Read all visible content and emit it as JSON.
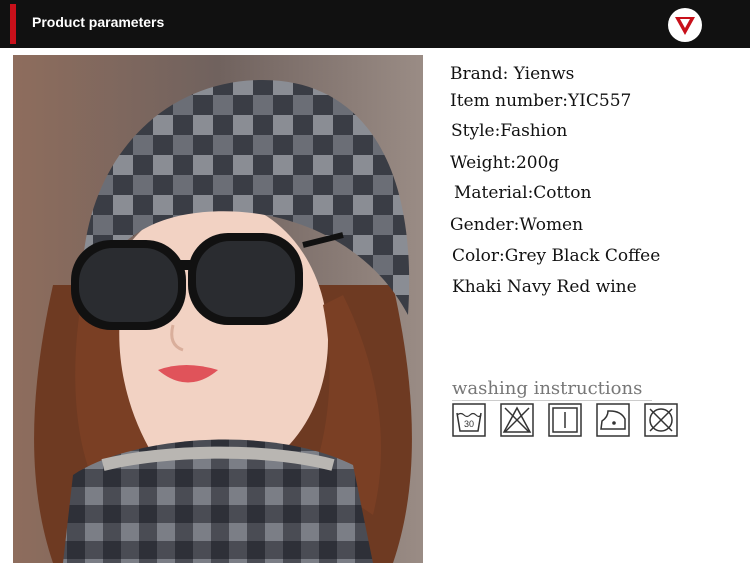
{
  "header": {
    "title": "Product parameters",
    "accent_color": "#c8101a",
    "logo_icon": "red-v-logo-icon"
  },
  "photo": {
    "subject": "woman-wearing-plaid-knit-beanie-scarf-and-sunglasses"
  },
  "params": [
    "Brand: Yienws",
    "Item number:YIC557",
    "Style:Fashion",
    "Weight:200g",
    "Material:Cotton",
    "Gender:Women",
    "Color:Grey Black Coffee",
    "Khaki Navy Red wine"
  ],
  "washing": {
    "title": "washing instructions",
    "wash_temp": "30",
    "icons": [
      "wash-30-icon",
      "do-not-bleach-icon",
      "line-dry-icon",
      "low-iron-icon",
      "do-not-dry-clean-icon"
    ]
  }
}
